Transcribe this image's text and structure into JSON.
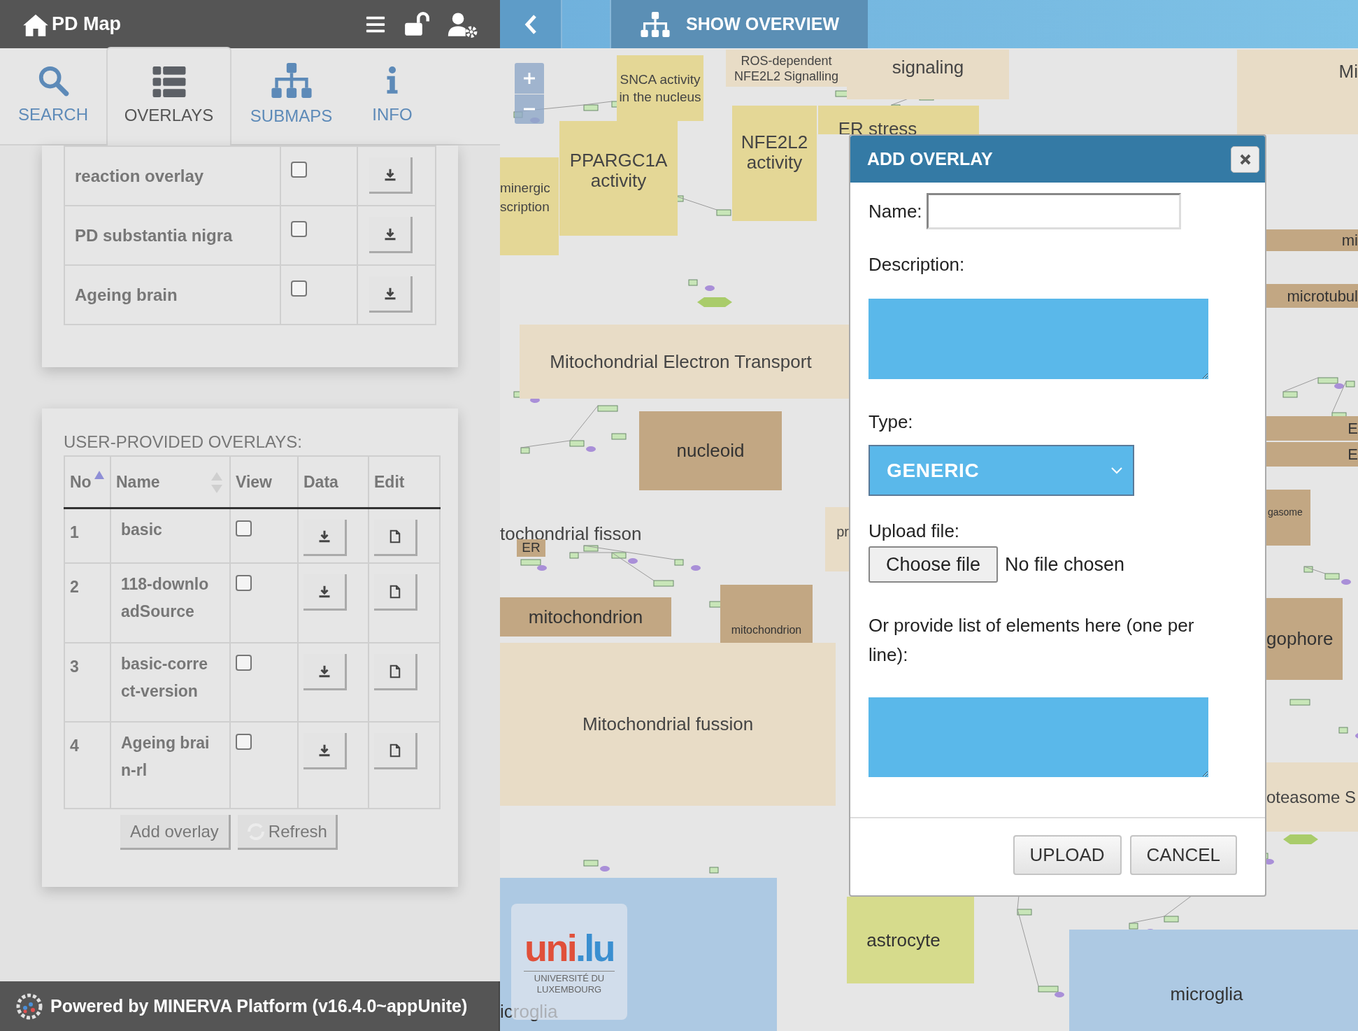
{
  "app_title": "PD Map",
  "tabs": [
    {
      "label": "SEARCH",
      "selected": false
    },
    {
      "label": "OVERLAYS",
      "selected": true
    },
    {
      "label": "SUBMAPS",
      "selected": false
    },
    {
      "label": "INFO",
      "selected": false
    }
  ],
  "general_overlays": [
    {
      "name": "reaction overlay",
      "checked": false
    },
    {
      "name": "PD substantia nigra",
      "checked": false
    },
    {
      "name": "Ageing brain",
      "checked": false
    }
  ],
  "user_overlays": {
    "heading": "USER-PROVIDED OVERLAYS:",
    "columns": [
      "No",
      "Name",
      "View",
      "Data",
      "Edit"
    ],
    "rows": [
      {
        "no": "1",
        "name": "basic",
        "checked": false
      },
      {
        "no": "2",
        "name": "118-downloadSource",
        "checked": false
      },
      {
        "no": "3",
        "name": "basic-correct-version",
        "checked": false
      },
      {
        "no": "4",
        "name": "Ageing brain-rl",
        "checked": false
      }
    ],
    "buttons": [
      "Add overlay",
      "Refresh"
    ]
  },
  "footer": "Powered by MINERVA Platform (v16.4.0~appUnite)",
  "map": {
    "overview_button": "SHOW OVERVIEW",
    "compartments": [
      {
        "label": "SNCA activity in the nucleus",
        "kind": "yellow"
      },
      {
        "label": "ROS-dependent NFE2L2 Signalling",
        "kind": "beige"
      },
      {
        "label": "signaling",
        "kind": "beige"
      },
      {
        "label": "Mi",
        "kind": "beige"
      },
      {
        "label": "PPARGC1A activity",
        "kind": "yellow"
      },
      {
        "label": "minergic scription",
        "kind": "yellow"
      },
      {
        "label": "NFE2L2 activity",
        "kind": "yellow"
      },
      {
        "label": "ER stress",
        "kind": "yellow"
      },
      {
        "label": "Mitochondrial Electron Transport",
        "kind": "beige"
      },
      {
        "label": "nucleoid",
        "kind": "brown"
      },
      {
        "label": "tochondrial fisson",
        "kind": "plain"
      },
      {
        "label": "ER",
        "kind": "brown"
      },
      {
        "label": "mitochondrion",
        "kind": "brown"
      },
      {
        "label": "mitochondrion",
        "kind": "brown"
      },
      {
        "label": "Mitochondrial fussion",
        "kind": "beige"
      },
      {
        "label": "pr",
        "kind": "beige"
      },
      {
        "label": "astrocyte",
        "kind": "green"
      },
      {
        "label": "icroglia",
        "kind": "blue"
      },
      {
        "label": "microglia",
        "kind": "blue"
      },
      {
        "label": "mi",
        "kind": "brown"
      },
      {
        "label": "microtubul",
        "kind": "brown"
      },
      {
        "label": "E",
        "kind": "brown"
      },
      {
        "label": "E",
        "kind": "brown"
      },
      {
        "label": "gasome",
        "kind": "brown"
      },
      {
        "label": "gophore",
        "kind": "brown"
      },
      {
        "label": "oteasome S",
        "kind": "beige"
      }
    ],
    "logo": {
      "mark_left": "uni",
      "mark_right": ".lu",
      "caption": "UNIVERSITÉ DU LUXEMBOURG"
    }
  },
  "dialog": {
    "title": "ADD OVERLAY",
    "name_label": "Name:",
    "description_label": "Description:",
    "type_label": "Type:",
    "type_value": "GENERIC",
    "upload_label": "Upload file:",
    "choose_button": "Choose file",
    "no_file": "No file chosen",
    "elements_label": "Or provide list of elements here (one per line):",
    "buttons": [
      "UPLOAD",
      "CANCEL"
    ]
  }
}
